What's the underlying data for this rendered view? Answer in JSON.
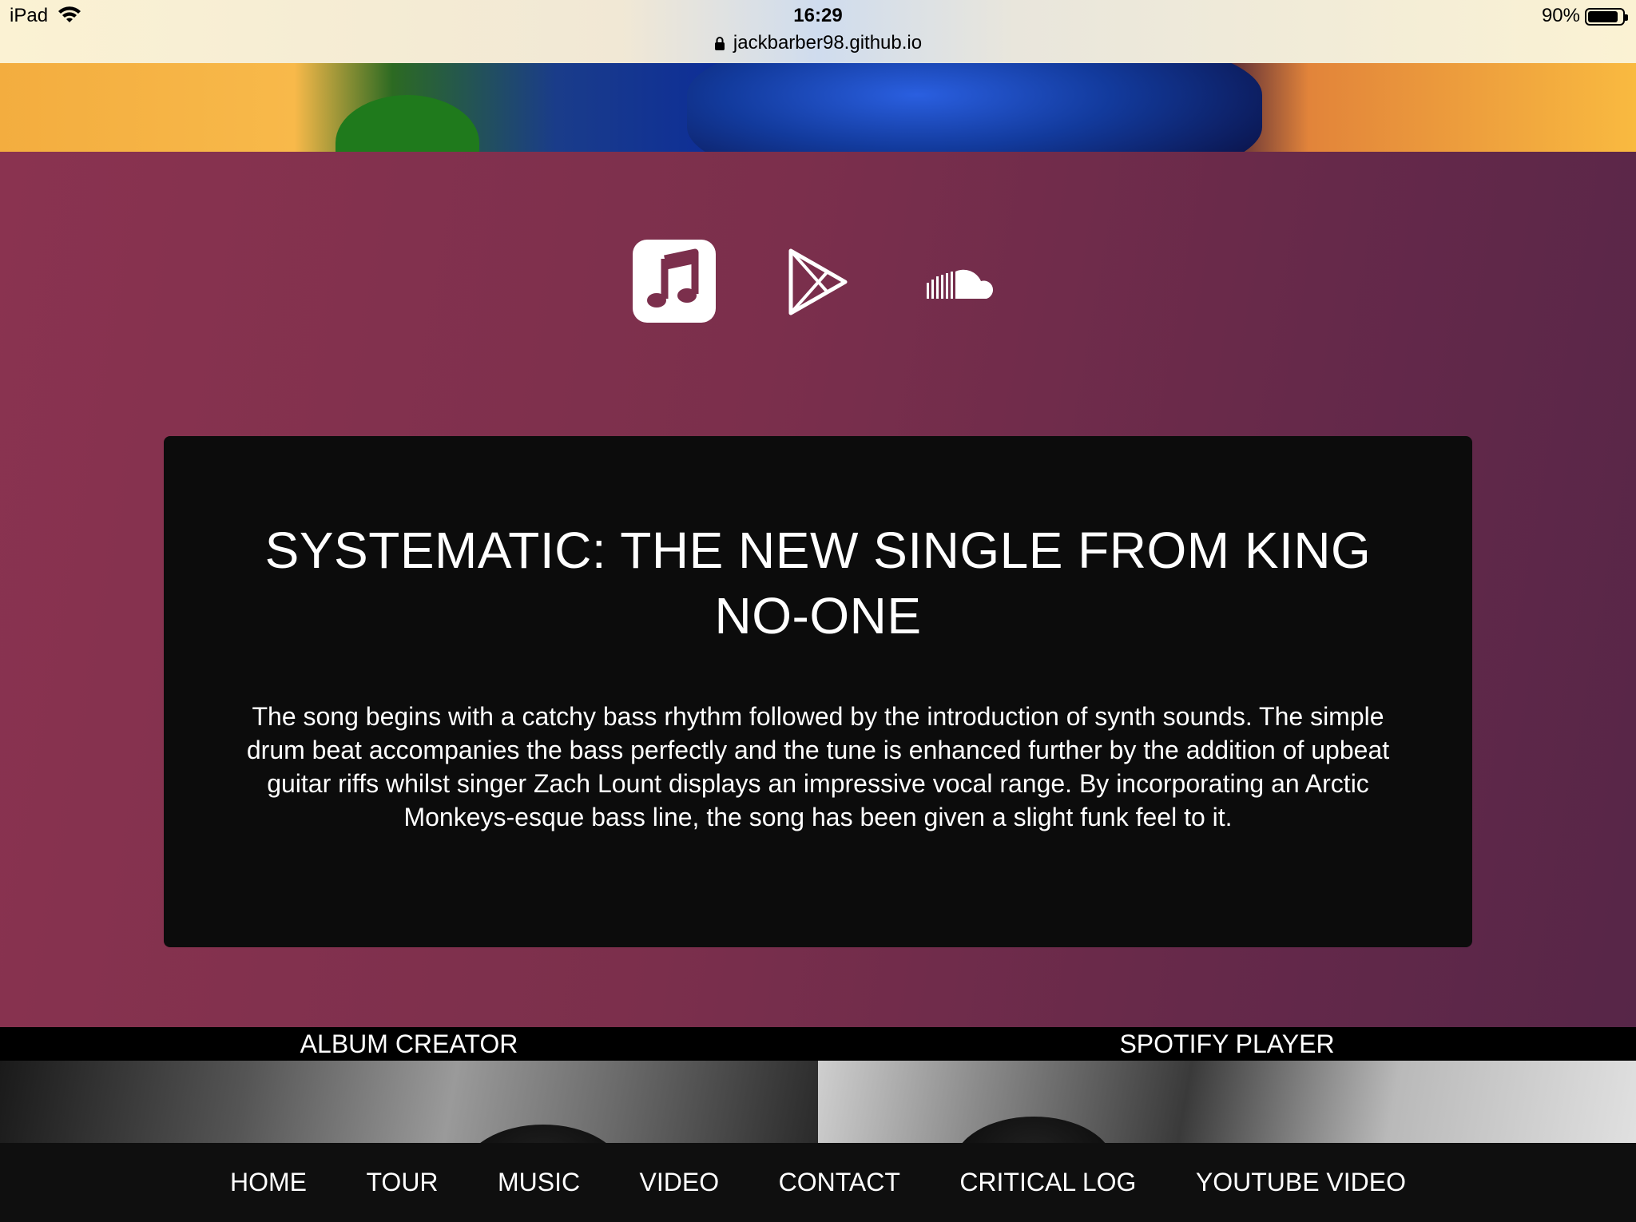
{
  "status_bar": {
    "device": "iPad",
    "time": "16:29",
    "url": "jackbarber98.github.io",
    "battery": "90%"
  },
  "icons": {
    "apple_music": "music-note-icon",
    "google_play": "play-triangle-icon",
    "soundcloud": "soundcloud-icon"
  },
  "card": {
    "title": "SYSTEMATIC: THE NEW SINGLE FROM KING NO-ONE",
    "body": "The song begins with a catchy bass rhythm followed by the introduction of synth sounds. The simple drum beat accompanies the bass perfectly and the tune is enhanced further by the addition of upbeat guitar riffs whilst singer Zach Lount displays an impressive vocal range. By incorporating an Arctic Monkeys-esque bass line, the song has been given a slight funk feel to it."
  },
  "features": [
    {
      "label": "ALBUM CREATOR"
    },
    {
      "label": "SPOTIFY PLAYER"
    }
  ],
  "nav": {
    "items": [
      "HOME",
      "TOUR",
      "MUSIC",
      "VIDEO",
      "CONTACT",
      "CRITICAL LOG",
      "YOUTUBE VIDEO"
    ]
  },
  "colors": {
    "background_gradient_start": "#8a3350",
    "background_gradient_end": "#572648",
    "card": "#0c0c0c",
    "nav": "#0f0f0f"
  }
}
